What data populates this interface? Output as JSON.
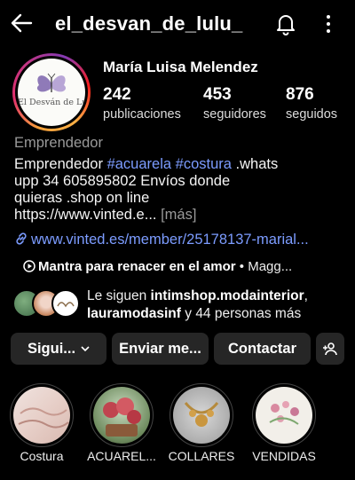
{
  "header": {
    "handle": "el_desvan_de_lulu_"
  },
  "profile": {
    "avatar_text": "El Desván de Lulú",
    "full_name": "María Luisa Melendez",
    "stats": [
      {
        "value": "242",
        "label": "publicaciones"
      },
      {
        "value": "453",
        "label": "seguidores"
      },
      {
        "value": "876",
        "label": "seguidos"
      }
    ],
    "category": "Emprendedor",
    "bio": {
      "line1_text": "Emprendedor ",
      "tag1": "#acuarela",
      "tag2": "#costura",
      "line1_tail": " .whats",
      "line2": "upp 34 605895802 Envíos donde",
      "line3": "quieras .shop on line",
      "line4": "https://www.vinted.e...",
      "more": "[más]"
    },
    "link": "www.vinted.es/member/25178137-marial...",
    "song": {
      "title": "Mantra para renacer en el amor",
      "artist": " • Magg..."
    },
    "followed_by": {
      "prefix": "Le siguen ",
      "user1": "intimshop.modainterior",
      "sep": ", ",
      "user2": "lauramodasinf",
      "suffix": " y 44 personas más"
    }
  },
  "actions": {
    "follow": "Sigui...",
    "message": "Enviar me...",
    "contact": "Contactar"
  },
  "highlights": [
    {
      "label": "Costura"
    },
    {
      "label": "ACUAREL..."
    },
    {
      "label": "COLLARES"
    },
    {
      "label": "VENDIDAS"
    }
  ],
  "colors": {
    "background": "#000000",
    "link": "#7c9cff",
    "button": "#262626"
  }
}
